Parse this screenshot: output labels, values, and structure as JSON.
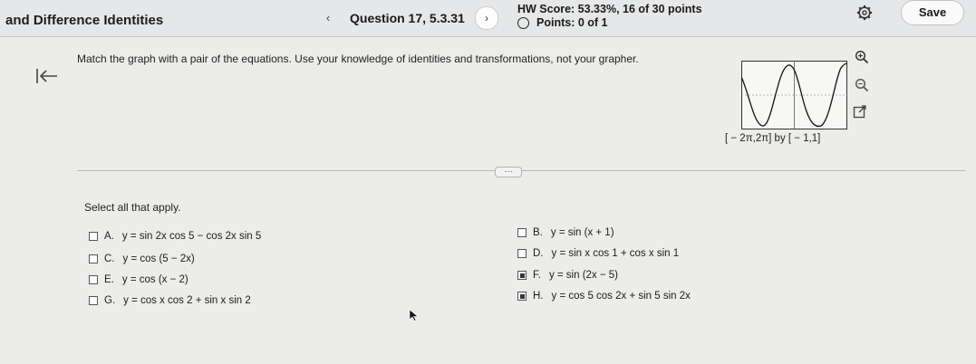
{
  "header": {
    "section_title": "and Difference Identities",
    "prev_icon": "chevron-left-icon",
    "question_label": "Question 17, 5.3.31",
    "next_icon": "chevron-right-icon",
    "hw_score": "HW Score: 53.33%, 16 of 30 points",
    "points": "Points: 0 of 1",
    "settings_icon": "gear-icon",
    "save_label": "Save"
  },
  "question": {
    "instructions": "Match the graph with a pair of the equations. Use your knowledge of identities and transformations, not your grapher.",
    "window_label": "[ − 2π,2π] by [ − 1,1]",
    "select_prompt": "Select all that apply.",
    "choices": [
      {
        "letter": "A.",
        "text": "y =  sin 2x cos 5 −  cos 2x sin 5",
        "checked": false
      },
      {
        "letter": "B.",
        "text": "y = sin (x + 1)",
        "checked": false
      },
      {
        "letter": "C.",
        "text": "y = cos (5 − 2x)",
        "checked": false
      },
      {
        "letter": "D.",
        "text": "y =  sin x cos 1 +  cos x sin 1",
        "checked": false
      },
      {
        "letter": "E.",
        "text": "y = cos (x − 2)",
        "checked": false
      },
      {
        "letter": "F.",
        "text": "y = sin (2x − 5)",
        "checked": true
      },
      {
        "letter": "G.",
        "text": "y =  cos x cos 2 +  sin x sin 2",
        "checked": false
      },
      {
        "letter": "H.",
        "text": "y =  cos 5 cos 2x +  sin 5 sin 2x",
        "checked": true
      }
    ]
  },
  "tools": {
    "zoom_in_icon": "zoom-in-icon",
    "zoom_out_icon": "zoom-out-icon",
    "popout_icon": "popout-icon"
  },
  "colors": {
    "accent": "#1a1a1a",
    "background": "#ececea"
  }
}
